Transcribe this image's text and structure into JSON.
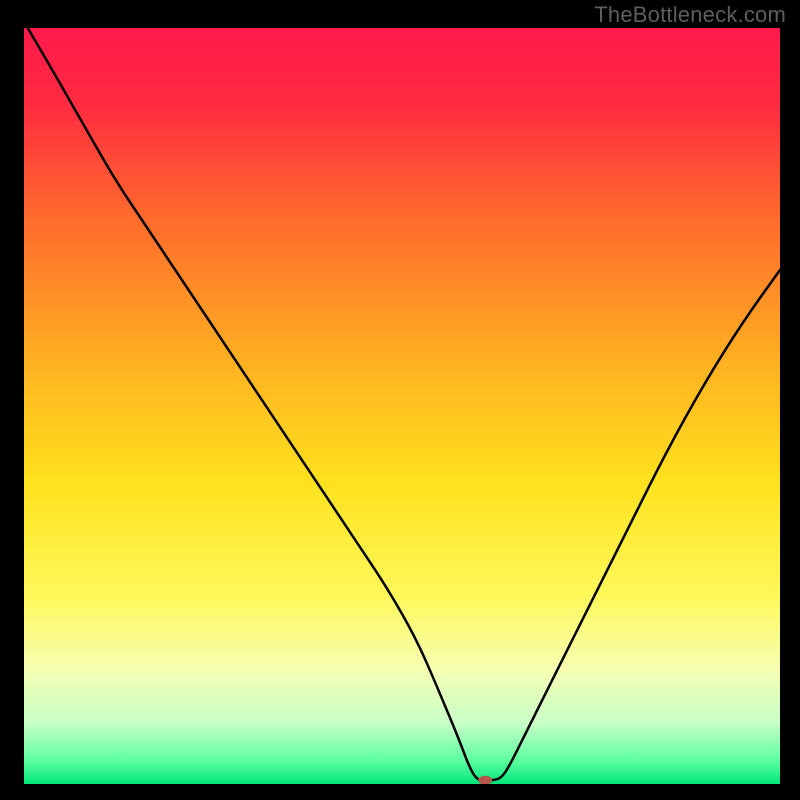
{
  "watermark": "TheBottleneck.com",
  "chart_data": {
    "type": "line",
    "title": "",
    "xlabel": "",
    "ylabel": "",
    "xlim": [
      0,
      100
    ],
    "ylim": [
      0,
      100
    ],
    "background_gradient": {
      "stops": [
        {
          "pos": 0.0,
          "color": "#ff1a4b"
        },
        {
          "pos": 0.1,
          "color": "#ff2b41"
        },
        {
          "pos": 0.25,
          "color": "#ff6a2d"
        },
        {
          "pos": 0.45,
          "color": "#ffb321"
        },
        {
          "pos": 0.6,
          "color": "#ffe11e"
        },
        {
          "pos": 0.75,
          "color": "#fff85a"
        },
        {
          "pos": 0.85,
          "color": "#f6ffb4"
        },
        {
          "pos": 0.92,
          "color": "#c7ffc7"
        },
        {
          "pos": 0.97,
          "color": "#5bffa0"
        },
        {
          "pos": 1.0,
          "color": "#00e57a"
        }
      ]
    },
    "series": [
      {
        "name": "bottleneck-curve",
        "color": "#000000",
        "stroke_width": 2.5,
        "x": [
          0.5,
          4,
          8,
          12,
          16,
          20,
          24,
          28,
          32,
          36,
          40,
          44,
          48,
          52,
          55,
          57.5,
          59,
          60,
          61,
          62,
          63,
          64,
          66,
          70,
          75,
          80,
          85,
          90,
          95,
          100
        ],
        "y": [
          100,
          94,
          87,
          80,
          74,
          68,
          62,
          56,
          50,
          44,
          38,
          32,
          26,
          19,
          12,
          6,
          2,
          0.5,
          0.5,
          0.5,
          0.7,
          2,
          6,
          14,
          24,
          34,
          44,
          53,
          61,
          68
        ]
      }
    ],
    "marker": {
      "name": "optimal-point",
      "x": 61,
      "y": 0.5,
      "color": "#b6574b",
      "rx": 7,
      "ry": 4.5
    }
  }
}
